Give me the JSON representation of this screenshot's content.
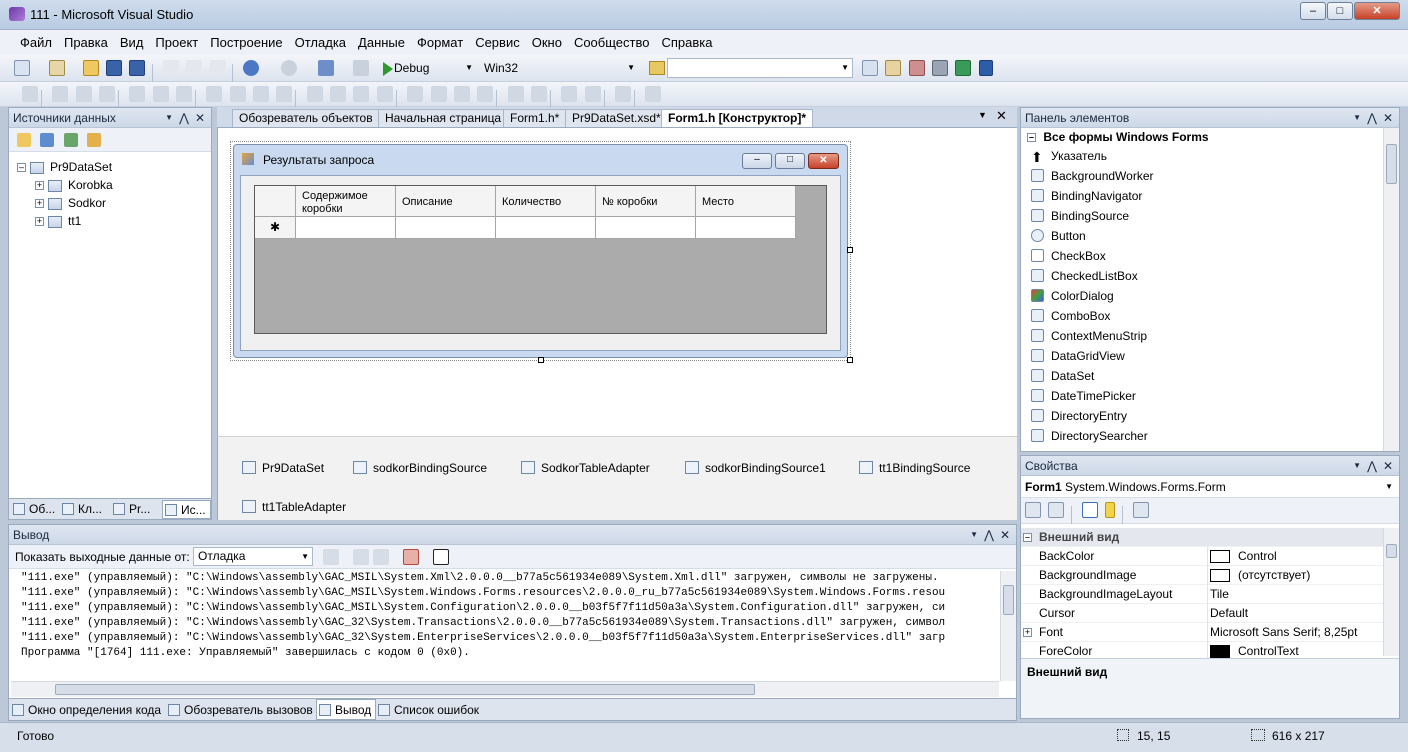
{
  "window": {
    "title": "111 - Microsoft Visual Studio"
  },
  "menu": [
    "Файл",
    "Правка",
    "Вид",
    "Проект",
    "Построение",
    "Отладка",
    "Данные",
    "Формат",
    "Сервис",
    "Окно",
    "Сообщество",
    "Справка"
  ],
  "toolbar": {
    "config": "Debug",
    "platform": "Win32",
    "find": ""
  },
  "data_sources": {
    "header": "Источники данных",
    "root": "Pr9DataSet",
    "items": [
      "Korobka",
      "Sodkor",
      "tt1"
    ],
    "tabs": [
      "Об...",
      "Кл...",
      "Pr...",
      "Ис..."
    ]
  },
  "doc_tabs": [
    "Обозреватель объектов",
    "Начальная страница",
    "Form1.h*",
    "Pr9DataSet.xsd*",
    "Form1.h [Конструктор]*"
  ],
  "form": {
    "title": "Результаты запроса",
    "columns": [
      "Содержимое коробки",
      "Описание",
      "Количество",
      "№ коробки",
      "Место"
    ],
    "new_row_marker": "✱"
  },
  "components": [
    "Pr9DataSet",
    "sodkorBindingSource",
    "SodkorTableAdapter",
    "sodkorBindingSource1",
    "tt1BindingSource",
    "tt1TableAdapter"
  ],
  "toolbox": {
    "header": "Панель элементов",
    "group": "Все формы Windows Forms",
    "items": [
      "Указатель",
      "BackgroundWorker",
      "BindingNavigator",
      "BindingSource",
      "Button",
      "CheckBox",
      "CheckedListBox",
      "ColorDialog",
      "ComboBox",
      "ContextMenuStrip",
      "DataGridView",
      "DataSet",
      "DateTimePicker",
      "DirectoryEntry",
      "DirectorySearcher"
    ]
  },
  "properties": {
    "header": "Свойства",
    "object_name": "Form1",
    "object_type": "System.Windows.Forms.Form",
    "category": "Внешний вид",
    "rows": [
      {
        "name": "BackColor",
        "value": "Control",
        "swatch": "#ffffff"
      },
      {
        "name": "BackgroundImage",
        "value": "(отсутствует)",
        "swatch": "#ffffff"
      },
      {
        "name": "BackgroundImageLayout",
        "value": "Tile"
      },
      {
        "name": "Cursor",
        "value": "Default"
      },
      {
        "name": "Font",
        "value": "Microsoft Sans Serif; 8,25pt"
      },
      {
        "name": "ForeColor",
        "value": "ControlText",
        "swatch": "#000000"
      }
    ],
    "description": "Внешний вид"
  },
  "output": {
    "header": "Вывод",
    "show_label": "Показать выходные данные от:",
    "source": "Отладка",
    "lines": [
      "\"111.exe\" (управляемый): \"C:\\Windows\\assembly\\GAC_MSIL\\System.Xml\\2.0.0.0__b77a5c561934e089\\System.Xml.dll\" загружен, символы не загружены.",
      "\"111.exe\" (управляемый): \"C:\\Windows\\assembly\\GAC_MSIL\\System.Windows.Forms.resources\\2.0.0.0_ru_b77a5c561934e089\\System.Windows.Forms.resou",
      "\"111.exe\" (управляемый): \"C:\\Windows\\assembly\\GAC_MSIL\\System.Configuration\\2.0.0.0__b03f5f7f11d50a3a\\System.Configuration.dll\" загружен, си",
      "\"111.exe\" (управляемый): \"C:\\Windows\\assembly\\GAC_32\\System.Transactions\\2.0.0.0__b77a5c561934e089\\System.Transactions.dll\" загружен, символ",
      "\"111.exe\" (управляемый): \"C:\\Windows\\assembly\\GAC_32\\System.EnterpriseServices\\2.0.0.0__b03f5f7f11d50a3a\\System.EnterpriseServices.dll\" загр",
      "Программа \"[1764] 111.exe: Управляемый\" завершилась с кодом 0 (0x0)."
    ]
  },
  "bottom_tabs": [
    "Окно определения кода",
    "Обозреватель вызовов",
    "Вывод",
    "Список ошибок"
  ],
  "status": {
    "text": "Готово",
    "position": "15, 15",
    "size": "616 x 217"
  },
  "colors": {
    "chrome": "#bcc7d8",
    "panel_header": "#cdd8e7",
    "form_title": "#c9daf0",
    "grid_bg": "#a9a9a9"
  }
}
